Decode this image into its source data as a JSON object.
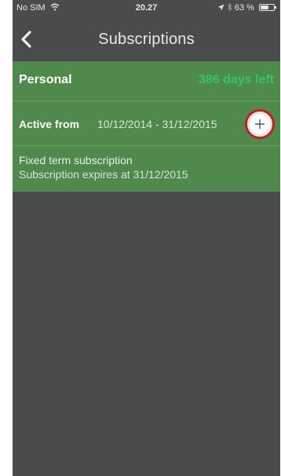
{
  "status_bar": {
    "carrier": "No SIM",
    "time": "20.27",
    "battery_percent": "63 %",
    "battery_level": 0.63
  },
  "nav": {
    "title": "Subscriptions",
    "back_icon": "chevron-left-icon"
  },
  "subscription": {
    "name": "Personal",
    "days_left": "386 days left",
    "active_label": "Active from",
    "active_dates": "10/12/2014 - 31/12/2015",
    "add_icon": "plus-icon",
    "term_type": "Fixed term subscription",
    "expires_text": "Subscription expires at 31/12/2015"
  },
  "colors": {
    "background": "#4a4b4c",
    "card": "#4f8a4c",
    "days_left": "#33c46a",
    "highlight_ring": "#c41f1f"
  }
}
